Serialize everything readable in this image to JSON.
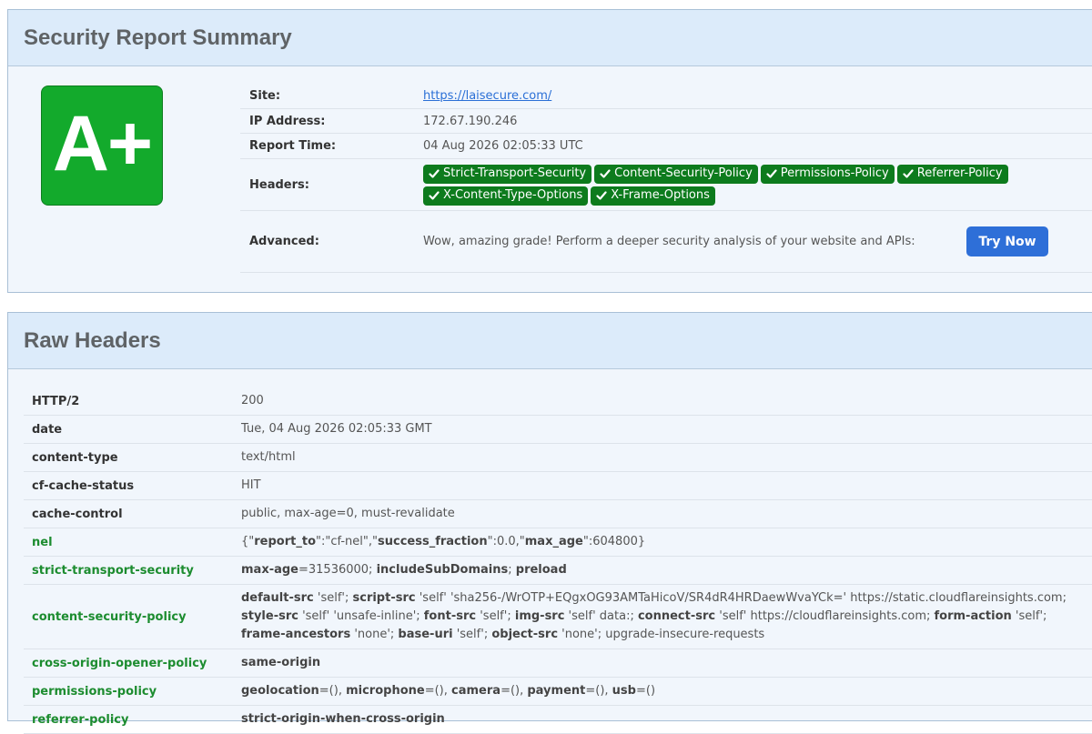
{
  "summary": {
    "title": "Security Report Summary",
    "grade": "A+",
    "grade_color": "#13aa2c",
    "rows": [
      {
        "label": "Site:",
        "value": "https://laisecure.com/"
      },
      {
        "label": "IP Address:",
        "value": "172.67.190.246"
      },
      {
        "label": "Report Time:",
        "value": "04 Aug 2026 02:05:33 UTC"
      },
      {
        "label": "Headers:"
      },
      {
        "label": "Advanced:",
        "value": "Wow, amazing grade! Perform a deeper security analysis of your website and APIs:"
      }
    ],
    "headers_badges": [
      "Strict-Transport-Security",
      "Content-Security-Policy",
      "Permissions-Policy",
      "Referrer-Policy",
      "X-Content-Type-Options",
      "X-Frame-Options"
    ],
    "badge_icon": "check-icon",
    "try_button": "Try Now"
  },
  "raw": {
    "title": "Raw Headers",
    "rows": [
      {
        "name": "HTTP/2",
        "value": "200"
      },
      {
        "name": "date",
        "value": "Tue, 04 Aug 2026 02:05:33 GMT"
      },
      {
        "name": "content-type",
        "value": "text/html"
      },
      {
        "name": "cf-cache-status",
        "value": "HIT"
      },
      {
        "name": "cache-control",
        "value": "public, max-age=0, must-revalidate"
      },
      {
        "name": "nel",
        "value_parts": [
          {
            "t": "{\""
          },
          {
            "t": "report_to",
            "b": true
          },
          {
            "t": "\":\"cf-nel\",\""
          },
          {
            "t": "success_fraction",
            "b": true
          },
          {
            "t": "\":0.0,\""
          },
          {
            "t": "max_age",
            "b": true
          },
          {
            "t": "\":604800}"
          }
        ]
      },
      {
        "name": "strict-transport-security",
        "value_parts": [
          {
            "t": "max-age",
            "b": true
          },
          {
            "t": "=31536000; "
          },
          {
            "t": "includeSubDomains",
            "b": true
          },
          {
            "t": "; "
          },
          {
            "t": "preload",
            "b": true
          }
        ]
      },
      {
        "name": "content-security-policy",
        "value_parts": [
          {
            "t": "default-src",
            "b": true
          },
          {
            "t": " 'self'; "
          },
          {
            "t": "script-src",
            "b": true
          },
          {
            "t": " 'self' 'sha256-/WrOTP+EQgxOG93AMTaHicoV/SR4dR4HRDaewWvaYCk=' https://static.cloudflareinsights.com; "
          },
          {
            "t": "style-src",
            "b": true
          },
          {
            "t": " 'self' 'unsafe-inline'; "
          },
          {
            "t": "font-src",
            "b": true
          },
          {
            "t": " 'self'; "
          },
          {
            "t": "img-src",
            "b": true
          },
          {
            "t": " 'self' data:; "
          },
          {
            "t": "connect-src",
            "b": true
          },
          {
            "t": " 'self' https://cloudflareinsights.com; "
          },
          {
            "t": "form-action",
            "b": true
          },
          {
            "t": " 'self'; "
          },
          {
            "t": "frame-ancestors",
            "b": true
          },
          {
            "t": " 'none'; "
          },
          {
            "t": "base-uri",
            "b": true
          },
          {
            "t": " 'self'; "
          },
          {
            "t": "object-src",
            "b": true
          },
          {
            "t": " 'none'; upgrade-insecure-requests"
          }
        ]
      },
      {
        "name": "cross-origin-opener-policy",
        "value_parts": [
          {
            "t": "same-origin",
            "b": true
          }
        ]
      },
      {
        "name": "permissions-policy",
        "value_parts": [
          {
            "t": "geolocation",
            "b": true
          },
          {
            "t": "=(), "
          },
          {
            "t": "microphone",
            "b": true
          },
          {
            "t": "=(), "
          },
          {
            "t": "camera",
            "b": true
          },
          {
            "t": "=(), "
          },
          {
            "t": "payment",
            "b": true
          },
          {
            "t": "=(), "
          },
          {
            "t": "usb",
            "b": true
          },
          {
            "t": "=()"
          }
        ]
      },
      {
        "name": "referrer-policy",
        "value_parts": [
          {
            "t": "strict-origin-when-cross-origin",
            "b": true
          }
        ]
      }
    ]
  }
}
